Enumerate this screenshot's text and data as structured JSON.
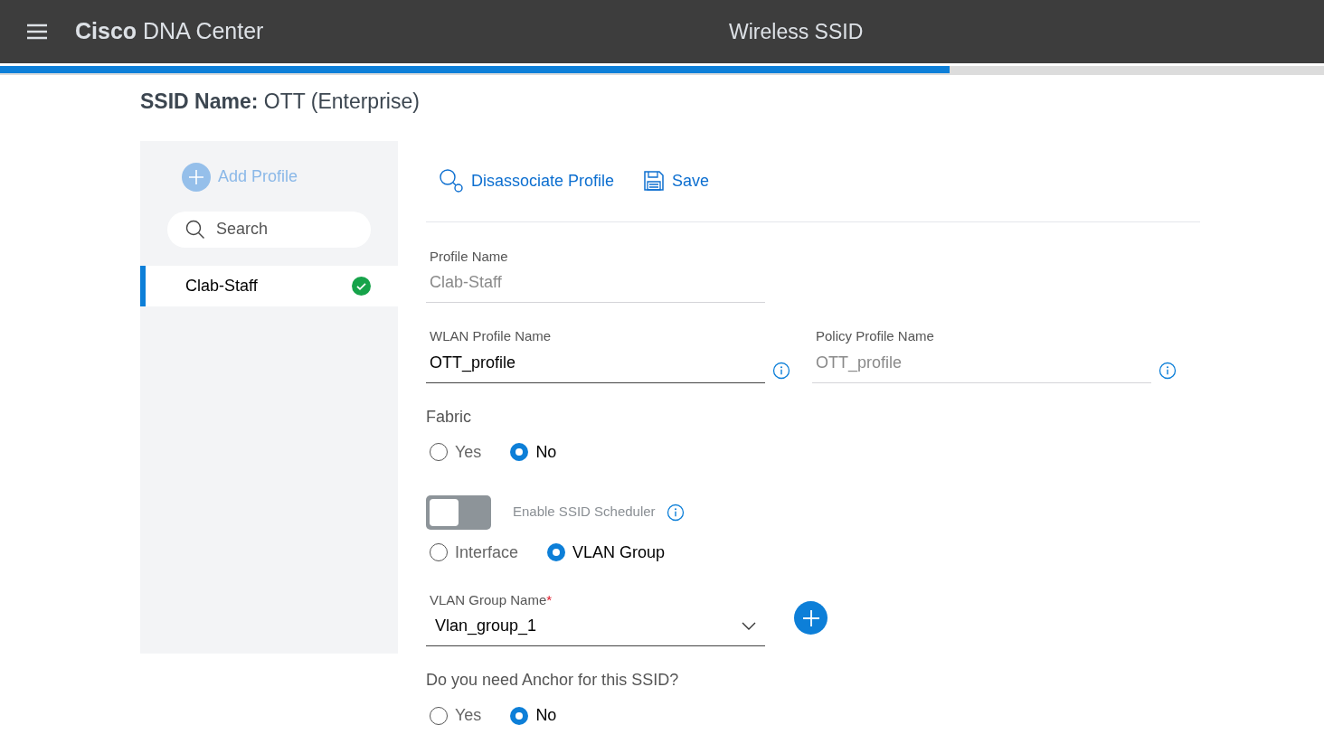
{
  "header": {
    "brand_bold": "Cisco",
    "brand": "DNA Center",
    "title": "Wireless SSID"
  },
  "progress": {
    "level": 0.717
  },
  "ssid_heading": "**SSID Name:** OTT (Enterprise)",
  "sidebar": {
    "add_label": "Add Profile",
    "search": {
      "placeholder": "Search"
    },
    "items": [
      {
        "label": "Clab-Staff",
        "selected": true,
        "valid": true
      }
    ]
  },
  "toolbar": [
    "Disassociate Profile",
    "Save"
  ],
  "profile_name": {
    "label": "Profile Name",
    "value": "Clab-Staff",
    "disabled": true
  },
  "wlan_profile_name": {
    "label": "WLAN Profile Name",
    "value": "OTT_profile",
    "disabled": false
  },
  "policy_profile_name": {
    "label": "Policy Profile Name",
    "value": "OTT_profile",
    "disabled": true
  },
  "fabric": {
    "label": "Fabric",
    "options": [
      {
        "label": "Yes",
        "selected": false
      },
      {
        "label": "No",
        "selected": true
      }
    ]
  },
  "scheduler": {
    "label": "Enable SSID Scheduler",
    "on": false
  },
  "mode": {
    "options": [
      {
        "label": "Interface",
        "selected": false
      },
      {
        "label": "VLAN Group",
        "selected": true
      }
    ]
  },
  "vlan_group": {
    "label": "VLAN Group Name",
    "required_mark": "*",
    "value": "Vlan_group_1"
  },
  "anchor": {
    "label": "Do you need Anchor for this SSID?",
    "options": [
      {
        "label": "Yes",
        "selected": false
      },
      {
        "label": "No",
        "selected": true
      }
    ]
  }
}
